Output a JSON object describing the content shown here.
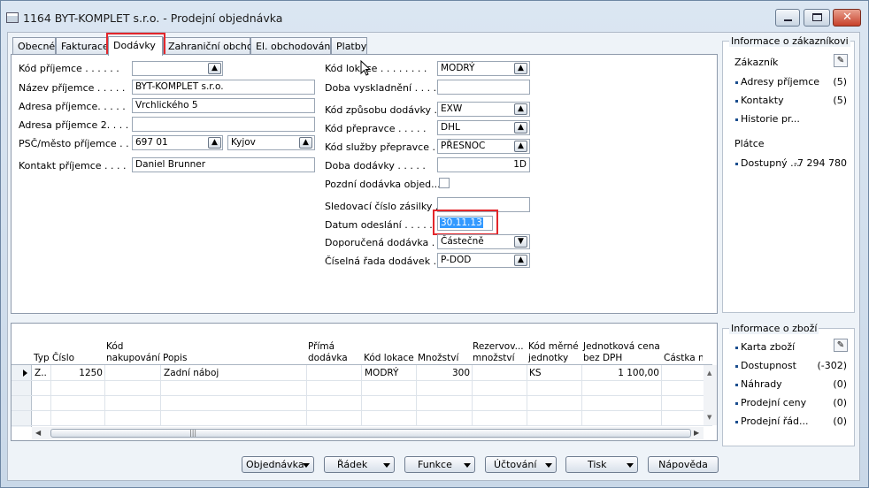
{
  "window": {
    "title": "1164 BYT-KOMPLET s.r.o. - Prodejní objednávka"
  },
  "tabs": [
    {
      "label": "Obecné"
    },
    {
      "label": "Fakturace"
    },
    {
      "label": "Dodávky"
    },
    {
      "label": "Zahraniční obchod"
    },
    {
      "label": "El. obchodování"
    },
    {
      "label": "Platby"
    }
  ],
  "active_tab": "Dodávky",
  "left_fields": {
    "kod_prijemce": {
      "label": "Kód příjemce . . . . . .",
      "value": ""
    },
    "nazev_prijemce": {
      "label": "Název příjemce . . . . .",
      "value": "BYT-KOMPLET s.r.o."
    },
    "adresa_prijemce": {
      "label": "Adresa příjemce. . . . .",
      "value": "Vrchlického 5"
    },
    "adresa_prijemce2": {
      "label": "Adresa příjemce 2. . . .",
      "value": ""
    },
    "psc_mesto": {
      "label": "PSČ/město příjemce . . .",
      "psc": "697 01",
      "mesto": "Kyjov"
    },
    "kontakt": {
      "label": "Kontakt příjemce . . . .",
      "value": "Daniel Brunner"
    }
  },
  "right_fields": {
    "kod_lokace": {
      "label": "Kód lokace . . . . . . . .",
      "value": "MODRÝ"
    },
    "doba_vyskladneni": {
      "label": "Doba vyskladnění . . . .",
      "value": ""
    },
    "kod_zpusobu_dodavky": {
      "label": "Kód způsobu dodávky . .",
      "value": "EXW"
    },
    "kod_prepravce": {
      "label": "Kód přepravce . . . . .",
      "value": "DHL"
    },
    "kod_sluzby_prepravce": {
      "label": "Kód služby přepravce . .",
      "value": "PŘESNOC"
    },
    "doba_dodavky": {
      "label": "Doba dodávky . . . . .",
      "value": "1D"
    },
    "pozdni_dodavka": {
      "label": "Pozdní dodávka objed...",
      "checked": false
    },
    "sledovaci_cislo": {
      "label": "Sledovací číslo zásilky . .",
      "value": ""
    },
    "datum_odeslani": {
      "label": "Datum odeslání . . . . .",
      "value": "30.11.13"
    },
    "doporucena_dodavka": {
      "label": "Doporučená dodávka . .",
      "value": "Částečně"
    },
    "ciselna_rada": {
      "label": "Číselná řada dodávek . .",
      "value": "P-DOD"
    }
  },
  "factbox_customer": {
    "title": "Informace o zákazníkovi",
    "zakaznik_label": "Zákazník",
    "rows": [
      {
        "label": "Adresy příjemce",
        "value": "(5)"
      },
      {
        "label": "Kontakty",
        "value": "(5)"
      },
      {
        "label": "Historie pr...",
        "value": ""
      }
    ],
    "platce_label": "Plátce",
    "dostupny": {
      "label": "Dostupný ...",
      "value": "-7 294 780"
    }
  },
  "factbox_item": {
    "title": "Informace o zboží",
    "rows": [
      {
        "label": "Karta zboží",
        "value": ""
      },
      {
        "label": "Dostupnost",
        "value": "(-302)"
      },
      {
        "label": "Náhrady",
        "value": "(0)"
      },
      {
        "label": "Prodejní ceny",
        "value": "(0)"
      },
      {
        "label": "Prodejní řád...",
        "value": "(0)"
      }
    ]
  },
  "lines": {
    "headers": {
      "typ": "Typ",
      "cislo": "Číslo",
      "kod_nakupovani": "Kód nakupování",
      "popis": "Popis",
      "prima_dodavka": "Přímá dodávka",
      "kod_lokace": "Kód lokace",
      "mnozstvi": "Množství",
      "rezervovane": "Rezervov... množství",
      "kod_merne": "Kód měrné jednotky",
      "jednotkova_cena": "Jednotková cena bez DPH",
      "castka": "Částka na"
    },
    "rows": [
      {
        "typ": "Z..",
        "cislo": "1250",
        "kod_nakupovani": "",
        "popis": "Zadní náboj",
        "prima_dodavka": "",
        "kod_lokace": "MODRÝ",
        "mnozstvi": "300",
        "rezervovane": "",
        "kod_merne": "KS",
        "jednotkova_cena": "1 100,00",
        "castka": ""
      }
    ]
  },
  "buttons": {
    "objednavka": "Objednávka",
    "radek": "Řádek",
    "funkce": "Funkce",
    "uctovani": "Účtování",
    "tisk": "Tisk",
    "napoveda": "Nápověda"
  },
  "colors": {
    "highlight_box": "#e3262b",
    "selection": "#3399ff",
    "link": "#1b4e8e"
  }
}
